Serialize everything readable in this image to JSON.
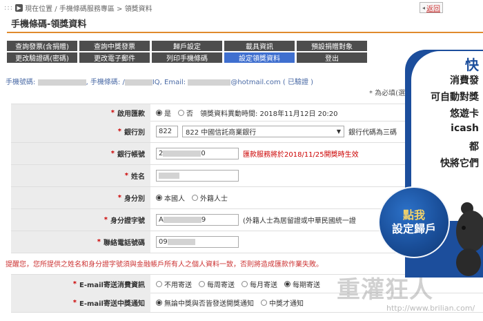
{
  "breadcrumb": {
    "prefix": ":::",
    "path": "現在位置 / 手機條碼服務專區 > 領獎資料"
  },
  "back": {
    "label": "返回"
  },
  "page_title": "手機條碼-領獎資料",
  "menu": [
    {
      "label": "查詢發票(含捐贈)"
    },
    {
      "label": "查詢中獎發票"
    },
    {
      "label": "歸戶設定"
    },
    {
      "label": "載具資訊"
    },
    {
      "label": "預設捐贈對象"
    },
    {
      "label": "更改驗證碼(密碼)"
    },
    {
      "label": "更改電子郵件"
    },
    {
      "label": "列印手機條碼"
    },
    {
      "label": "設定領獎資料",
      "active": true
    },
    {
      "label": "登出"
    }
  ],
  "account": {
    "phone_label": "手機號碼:",
    "barcode_label": ", 手機條碼: /",
    "barcode_suffix": "IQ",
    "email_label": ", Email:",
    "email_suffix": "@hotmail.com",
    "verified": "( 已驗證 )"
  },
  "required_note": "* 為必填(選",
  "form": {
    "enable": {
      "label": "啟用匯款",
      "opt_yes": "是",
      "opt_no": "否",
      "change_time": "領獎資料異動時間: 2018年11月12日 20:20"
    },
    "bank": {
      "label": "銀行別",
      "code": "822",
      "selected": "822 中國信託商業銀行",
      "hint": "銀行代碼為三碼"
    },
    "account_no": {
      "label": "銀行帳號",
      "value_start": "2",
      "value_end": "0",
      "notice": "匯款服務將於2018/11/25開獎時生效"
    },
    "name": {
      "label": "姓名"
    },
    "identity": {
      "label": "身分別",
      "opt_local": "本國人",
      "opt_foreign": "外籍人士"
    },
    "id_no": {
      "label": "身分證字號",
      "value_start": "A",
      "value_end": "9",
      "hint": "(外籍人士為居留證或中華民國統一證"
    },
    "phone": {
      "label": "聯絡電話號碼",
      "value_start": "09"
    }
  },
  "warning": "提醒您，您所提供之姓名和身分證字號須與金融帳戶所有人之個人資料一致，否則將造成匯款作業失敗。",
  "email_notify": {
    "label": "E-mail寄送消費資訊",
    "options": [
      "不用寄送",
      "每周寄送",
      "每月寄送",
      "每期寄送"
    ],
    "selected_index": 3
  },
  "prize_notify": {
    "label": "E-mail寄送中獎通知",
    "options": [
      "無論中獎與否皆發送開獎通知",
      "中獎才通知"
    ],
    "selected_index": 0
  },
  "ad": {
    "lines": [
      "快",
      "消費發",
      "可自動對獎",
      "悠遊卡",
      "icash",
      "都",
      "快將它們"
    ],
    "button_line1": "點我",
    "button_line2": "設定歸戶"
  },
  "watermark": {
    "text": "重灌狂人",
    "url": "http://www.brilian.com/"
  },
  "colors": {
    "accent_orange": "#e08a2c",
    "menu_dark": "#4d4d4d",
    "menu_active": "#3f6fcf",
    "ad_blue": "#1c4e9c"
  }
}
